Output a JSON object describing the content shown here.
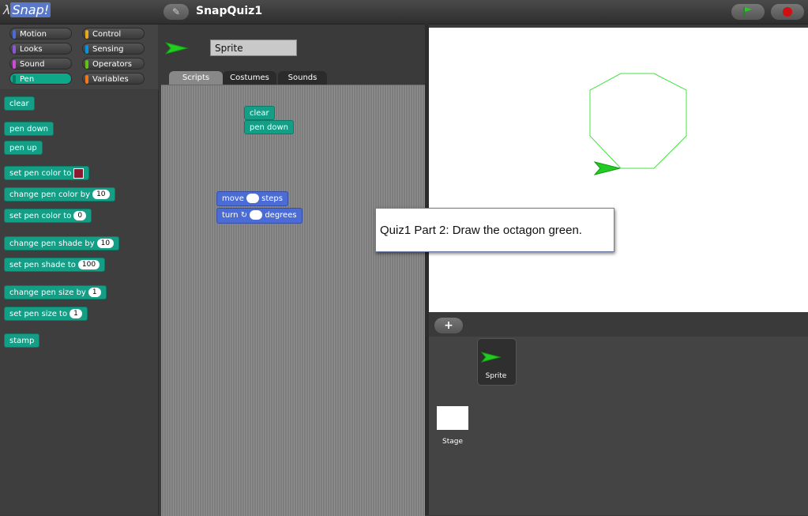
{
  "header": {
    "logo_text": "Snap!",
    "project_title": "SnapQuiz1",
    "settings_icon": "pencil-icon",
    "flag_icon": "green-flag-icon",
    "stop_icon": "stop-sign-icon"
  },
  "categories": [
    {
      "label": "Motion",
      "color": "#4a6cd4",
      "selected": false
    },
    {
      "label": "Control",
      "color": "#e6a822",
      "selected": false
    },
    {
      "label": "Looks",
      "color": "#8a55d7",
      "selected": false
    },
    {
      "label": "Sensing",
      "color": "#0494dc",
      "selected": false
    },
    {
      "label": "Sound",
      "color": "#cf4ad9",
      "selected": false
    },
    {
      "label": "Operators",
      "color": "#62c213",
      "selected": false
    },
    {
      "label": "Pen",
      "color": "#0fa78a",
      "selected": true
    },
    {
      "label": "Variables",
      "color": "#f3761d",
      "selected": false
    }
  ],
  "palette": {
    "clear": "clear",
    "pen_down": "pen down",
    "pen_up": "pen up",
    "set_color_label": "set pen color to",
    "change_color_label": "change pen color by",
    "change_color_value": "10",
    "set_color_to_label": "set pen color to",
    "set_color_to_value": "0",
    "change_shade_label": "change pen shade by",
    "change_shade_value": "10",
    "set_shade_label": "set pen shade to",
    "set_shade_value": "100",
    "change_size_label": "change pen size by",
    "change_size_value": "1",
    "set_size_label": "set pen size to",
    "set_size_value": "1",
    "stamp": "stamp",
    "pen_color_swatch": "#8b1a2e"
  },
  "sprite": {
    "name": "Sprite",
    "tabs": [
      "Scripts",
      "Costumes",
      "Sounds"
    ],
    "active_tab": "Scripts"
  },
  "scripts": {
    "clear": "clear",
    "pen_down": "pen down",
    "move_label": "move",
    "move_unit": "steps",
    "turn_label": "turn",
    "turn_unit": "degrees"
  },
  "stage": {
    "octagon_stroke": "#44e044",
    "sprite_color": "#22cc22"
  },
  "quiz": {
    "text": "Quiz1 Part 2:  Draw the octagon green."
  },
  "corral": {
    "add_icon": "plus-icon",
    "sprite_label": "Sprite",
    "stage_label": "Stage"
  }
}
